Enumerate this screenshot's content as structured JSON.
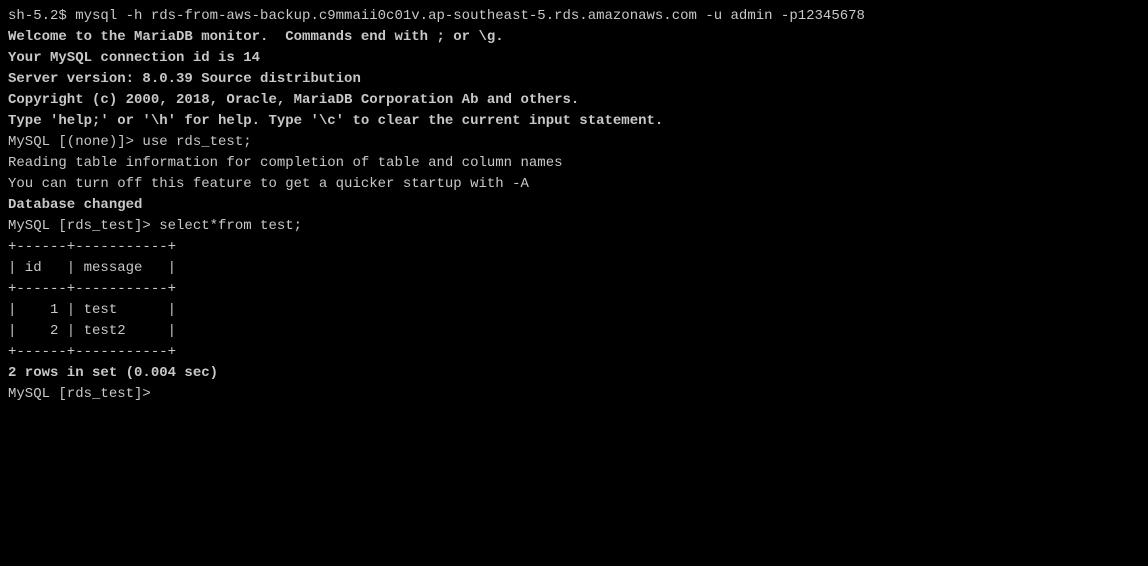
{
  "terminal": {
    "lines": [
      {
        "id": "line1",
        "text": "sh-5.2$ mysql -h rds-from-aws-backup.c9mmaii0c01v.ap-southeast-5.rds.amazonaws.com -u admin -p12345678",
        "bold": false
      },
      {
        "id": "line2",
        "text": "Welcome to the MariaDB monitor.  Commands end with ; or \\g.",
        "bold": true
      },
      {
        "id": "line3",
        "text": "Your MySQL connection id is 14",
        "bold": true
      },
      {
        "id": "line4",
        "text": "Server version: 8.0.39 Source distribution",
        "bold": true
      },
      {
        "id": "line5",
        "text": "",
        "bold": false
      },
      {
        "id": "line6",
        "text": "Copyright (c) 2000, 2018, Oracle, MariaDB Corporation Ab and others.",
        "bold": true
      },
      {
        "id": "line7",
        "text": "",
        "bold": false
      },
      {
        "id": "line8",
        "text": "Type 'help;' or '\\h' for help. Type '\\c' to clear the current input statement.",
        "bold": true
      },
      {
        "id": "line9",
        "text": "",
        "bold": false
      },
      {
        "id": "line10",
        "text": "MySQL [(none)]> use rds_test;",
        "bold": false
      },
      {
        "id": "line11",
        "text": "Reading table information for completion of table and column names",
        "bold": false
      },
      {
        "id": "line12",
        "text": "You can turn off this feature to get a quicker startup with -A",
        "bold": false
      },
      {
        "id": "line13",
        "text": "",
        "bold": false
      },
      {
        "id": "line14",
        "text": "Database changed",
        "bold": true
      },
      {
        "id": "line15",
        "text": "MySQL [rds_test]> select*from test;",
        "bold": false
      },
      {
        "id": "line16",
        "text": "+------+-----------+",
        "bold": false
      },
      {
        "id": "line17",
        "text": "| id   | message   |",
        "bold": false
      },
      {
        "id": "line18",
        "text": "+------+-----------+",
        "bold": false
      },
      {
        "id": "line19",
        "text": "|    1 | test      |",
        "bold": false
      },
      {
        "id": "line20",
        "text": "|    2 | test2     |",
        "bold": false
      },
      {
        "id": "line21",
        "text": "+------+-----------+",
        "bold": false
      },
      {
        "id": "line22",
        "text": "2 rows in set (0.004 sec)",
        "bold": true
      },
      {
        "id": "line23",
        "text": "",
        "bold": false
      },
      {
        "id": "line24",
        "text": "MySQL [rds_test]>",
        "bold": false
      }
    ]
  }
}
